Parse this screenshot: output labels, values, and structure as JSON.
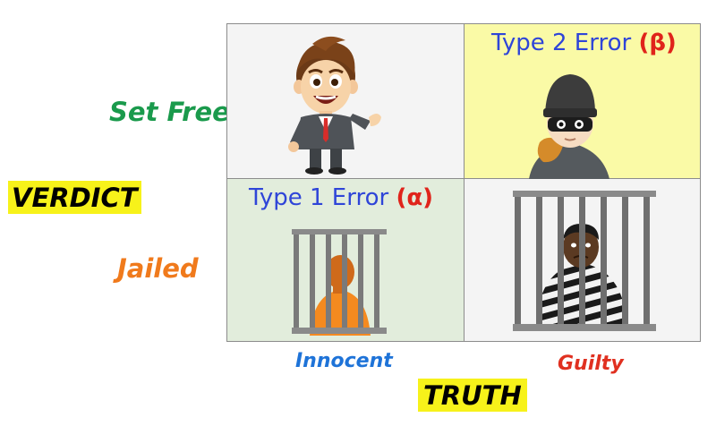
{
  "verdict_axis": {
    "title": "VERDICT",
    "rows": [
      "Set Free",
      "Jailed"
    ]
  },
  "truth_axis": {
    "title": "TRUTH",
    "columns": [
      "Innocent",
      "Guilty"
    ]
  },
  "cells": {
    "free_innocent": {
      "illustration": "happy-businessman"
    },
    "free_guilty": {
      "title": "Type 2 Error",
      "symbol": "(β)",
      "illustration": "masked-thief"
    },
    "jailed_innocent": {
      "title": "Type 1 Error",
      "symbol": "(α)",
      "illustration": "jailed-prisoner"
    },
    "jailed_guilty": {
      "illustration": "striped-prisoner-behind-bars"
    }
  },
  "colors": {
    "set_free": "#1a9a4c",
    "jailed": "#f07a1c",
    "innocent": "#1e73d8",
    "guilty": "#e03020",
    "highlight": "#f7f21a",
    "type2_bg": "#fafaa6",
    "type1_bg": "#e2eddc",
    "error_title": "#2f45d8",
    "error_symbol": "#e0241b"
  }
}
